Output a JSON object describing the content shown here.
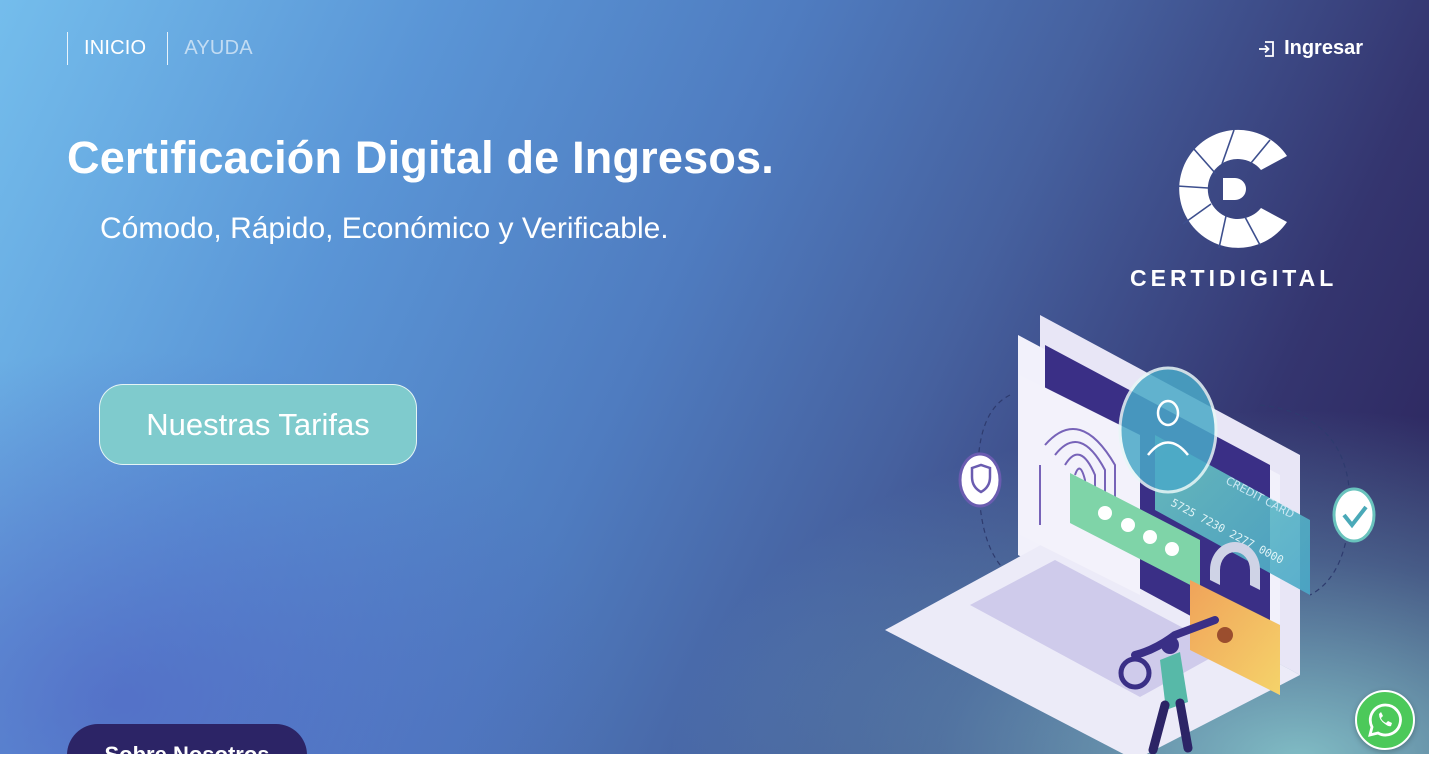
{
  "nav": {
    "items": [
      {
        "label": "INICIO"
      },
      {
        "label": "AYUDA"
      }
    ],
    "login_label": "Ingresar",
    "login_icon": "sign-in-icon"
  },
  "hero": {
    "title": "Certificación Digital de Ingresos.",
    "subtitle": "Cómodo, Rápido, Económico y Verificable.",
    "cta_label": "Nuestras Tarifas",
    "about_label": "Sobre Nosotros"
  },
  "brand": {
    "name": "CERTIDIGITAL",
    "icon": "certidigital-logo-icon"
  },
  "illustration": {
    "card_number": "5725 7230 2277 0000",
    "card_label": "CREDIT CARD"
  },
  "floating": {
    "whatsapp_icon": "whatsapp-icon"
  },
  "colors": {
    "accent_teal": "#7fcbcd",
    "dark_purple": "#2c2466",
    "whatsapp_green": "#4cc95a"
  }
}
